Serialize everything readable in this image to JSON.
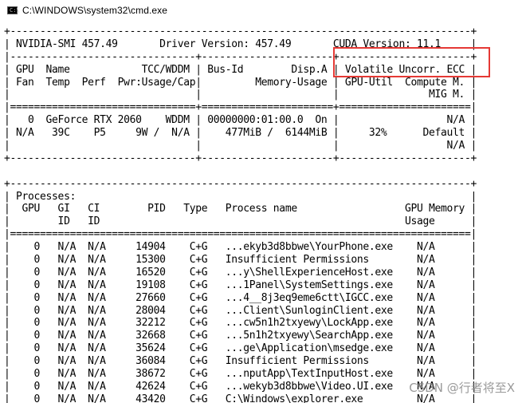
{
  "window": {
    "title": "C:\\WINDOWS\\system32\\cmd.exe",
    "icon": "cmd-console-icon",
    "icon_glyph": "C:\\"
  },
  "highlight_color": "#e53935",
  "console": {
    "lines": [
      "+-----------------------------------------------------------------------------+",
      "| NVIDIA-SMI 457.49       Driver Version: 457.49       CUDA Version: 11.1     |",
      "|-------------------------------+----------------------+----------------------+",
      "| GPU  Name            TCC/WDDM | Bus-Id        Disp.A | Volatile Uncorr. ECC |",
      "| Fan  Temp  Perf  Pwr:Usage/Cap|         Memory-Usage | GPU-Util  Compute M. |",
      "|                               |                      |               MIG M. |",
      "|===============================+======================+======================|",
      "|   0  GeForce RTX 2060    WDDM | 00000000:01:00.0  On |                  N/A |",
      "| N/A   39C    P5     9W /  N/A |    477MiB /  6144MiB |     32%      Default |",
      "|                               |                      |                  N/A |",
      "+-------------------------------+----------------------+----------------------+",
      "",
      "+-----------------------------------------------------------------------------+",
      "| Processes:                                                                  |",
      "|  GPU   GI   CI        PID   Type   Process name                  GPU Memory |",
      "|        ID   ID                                                   Usage      |",
      "|=============================================================================|",
      "|    0   N/A  N/A     14904    C+G   ...ekyb3d8bbwe\\YourPhone.exe    N/A      |",
      "|    0   N/A  N/A     15300    C+G   Insufficient Permissions        N/A      |",
      "|    0   N/A  N/A     16520    C+G   ...y\\ShellExperienceHost.exe    N/A      |",
      "|    0   N/A  N/A     19108    C+G   ...1Panel\\SystemSettings.exe    N/A      |",
      "|    0   N/A  N/A     27660    C+G   ...4__8j3eq9eme6ctt\\IGCC.exe    N/A      |",
      "|    0   N/A  N/A     28004    C+G   ...Client\\SunloginClient.exe    N/A      |",
      "|    0   N/A  N/A     32212    C+G   ...cw5n1h2txyewy\\LockApp.exe    N/A      |",
      "|    0   N/A  N/A     32668    C+G   ...5n1h2txyewy\\SearchApp.exe    N/A      |",
      "|    0   N/A  N/A     35624    C+G   ...ge\\Application\\msedge.exe    N/A      |",
      "|    0   N/A  N/A     36084    C+G   Insufficient Permissions        N/A      |",
      "|    0   N/A  N/A     38672    C+G   ...nputApp\\TextInputHost.exe    N/A      |",
      "|    0   N/A  N/A     42624    C+G   ...wekyb3d8bbwe\\Video.UI.exe    N/A      |",
      "|    0   N/A  N/A     43420    C+G   C:\\Windows\\explorer.exe         N/A      |"
    ]
  },
  "watermark": "CSDN @行者将至X"
}
